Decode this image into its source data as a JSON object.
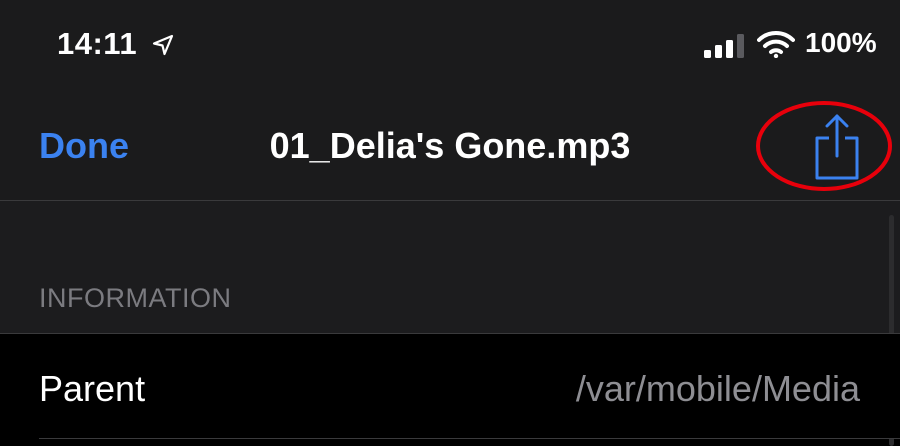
{
  "status_bar": {
    "time": "14:11",
    "battery": "100%",
    "icons": [
      "location-arrow-icon",
      "cellular-signal-icon",
      "wifi-icon"
    ]
  },
  "nav": {
    "done_label": "Done",
    "title": "01_Delia's Gone.mp3",
    "share_icon": "share-icon"
  },
  "section": {
    "header": "INFORMATION"
  },
  "rows": [
    {
      "label": "Parent",
      "value": "/var/mobile/Media"
    }
  ],
  "colors": {
    "accent": "#3b82f0",
    "highlight": "#e8000b",
    "background": "#000000",
    "bar": "#1b1b1c"
  }
}
